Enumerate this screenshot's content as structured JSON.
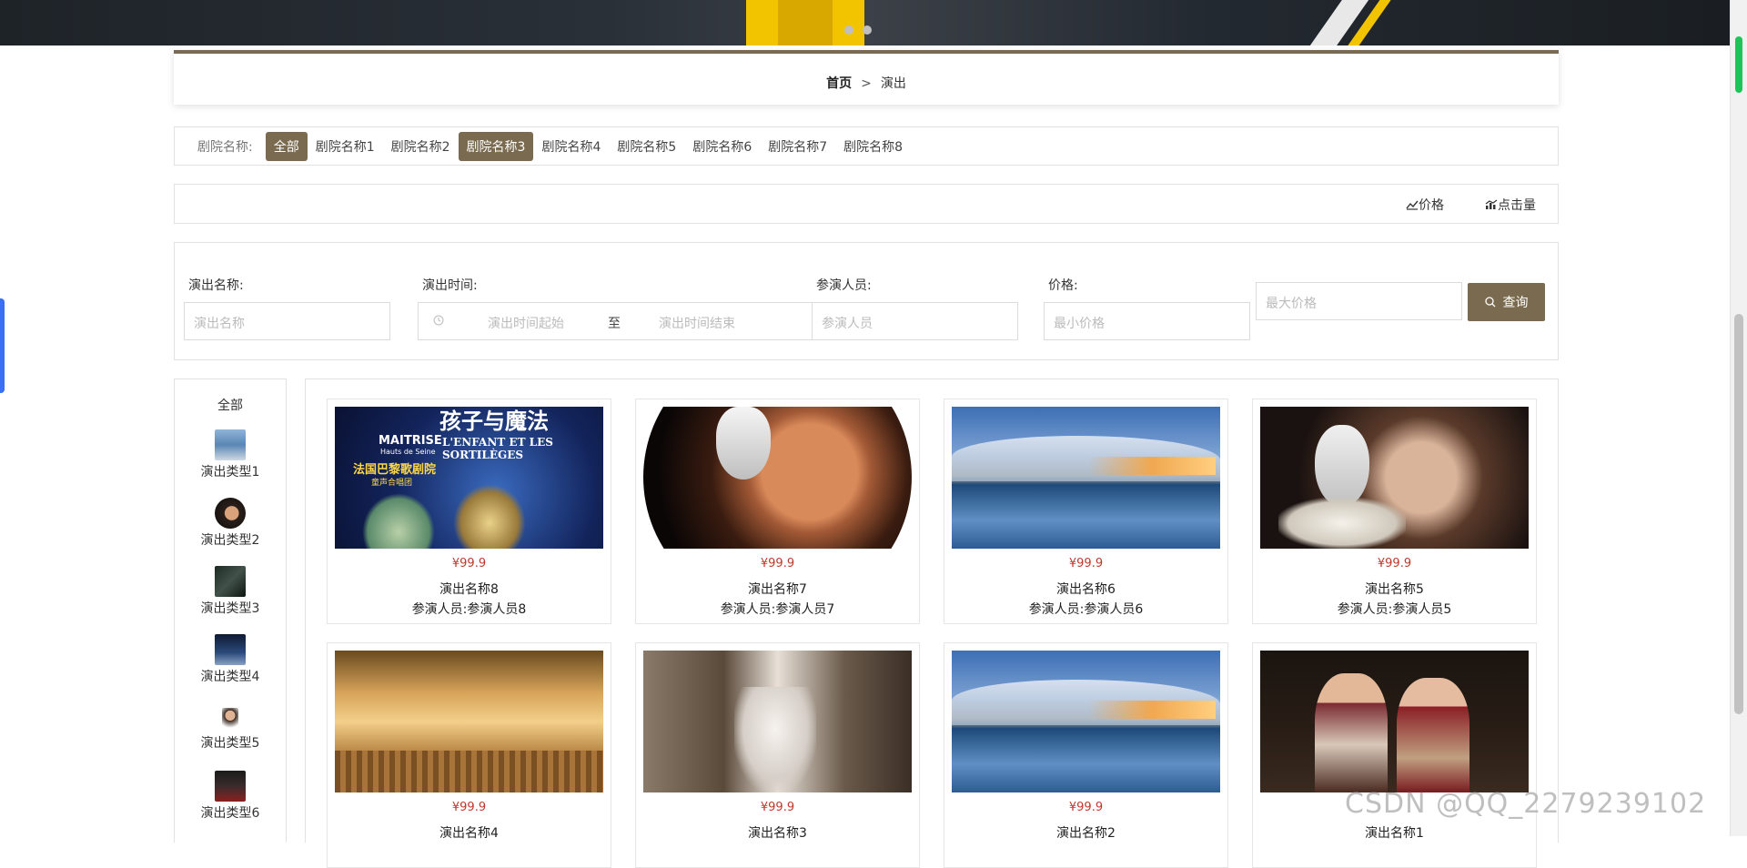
{
  "breadcrumb": {
    "home": "首页",
    "separator": ">",
    "current": "演出"
  },
  "theater_filter": {
    "label": "剧院名称:",
    "options": [
      "全部",
      "剧院名称1",
      "剧院名称2",
      "剧院名称3",
      "剧院名称4",
      "剧院名称5",
      "剧院名称6",
      "剧院名称7",
      "剧院名称8"
    ],
    "highlighted": [
      "全部",
      "剧院名称3"
    ]
  },
  "sort": {
    "price": "价格",
    "clicks": "点击量",
    "price_icon": "trend-icon",
    "clicks_icon": "bar-chart-icon"
  },
  "search": {
    "name_label": "演出名称:",
    "name_placeholder": "演出名称",
    "time_label": "演出时间:",
    "time_start_placeholder": "演出时间起始",
    "time_to": "至",
    "time_end_placeholder": "演出时间结束",
    "cast_label": "参演人员:",
    "cast_placeholder": "参演人员",
    "price_label": "价格:",
    "min_price_placeholder": "最小价格",
    "max_price_placeholder": "最大价格",
    "query_button": "查询"
  },
  "categories": {
    "all": "全部",
    "items": [
      "演出类型1",
      "演出类型2",
      "演出类型3",
      "演出类型4",
      "演出类型5",
      "演出类型6"
    ]
  },
  "shows": [
    {
      "price": "¥99.9",
      "name": "演出名称8",
      "cast": "参演人员:参演人员8"
    },
    {
      "price": "¥99.9",
      "name": "演出名称7",
      "cast": "参演人员:参演人员7"
    },
    {
      "price": "¥99.9",
      "name": "演出名称6",
      "cast": "参演人员:参演人员6"
    },
    {
      "price": "¥99.9",
      "name": "演出名称5",
      "cast": "参演人员:参演人员5"
    },
    {
      "price": "¥99.9",
      "name": "演出名称4",
      "cast": ""
    },
    {
      "price": "¥99.9",
      "name": "演出名称3",
      "cast": ""
    },
    {
      "price": "¥99.9",
      "name": "演出名称2",
      "cast": ""
    },
    {
      "price": "",
      "name": "演出名称1",
      "cast": ""
    }
  ],
  "poster_text": {
    "title_cn": "孩子与魔法",
    "brand": "MAITRISE",
    "brand_sub": "Hauts de Seine",
    "title_fr": "L'ENFANT ET LES SORTILÈGES",
    "subtitle_cn": "法国巴黎歌剧院",
    "subtitle_cn2": "童声合唱团"
  },
  "watermark": "CSDN @QQ_2279239102",
  "colors": {
    "accent": "#7a6a4f",
    "price": "#c0392b"
  }
}
